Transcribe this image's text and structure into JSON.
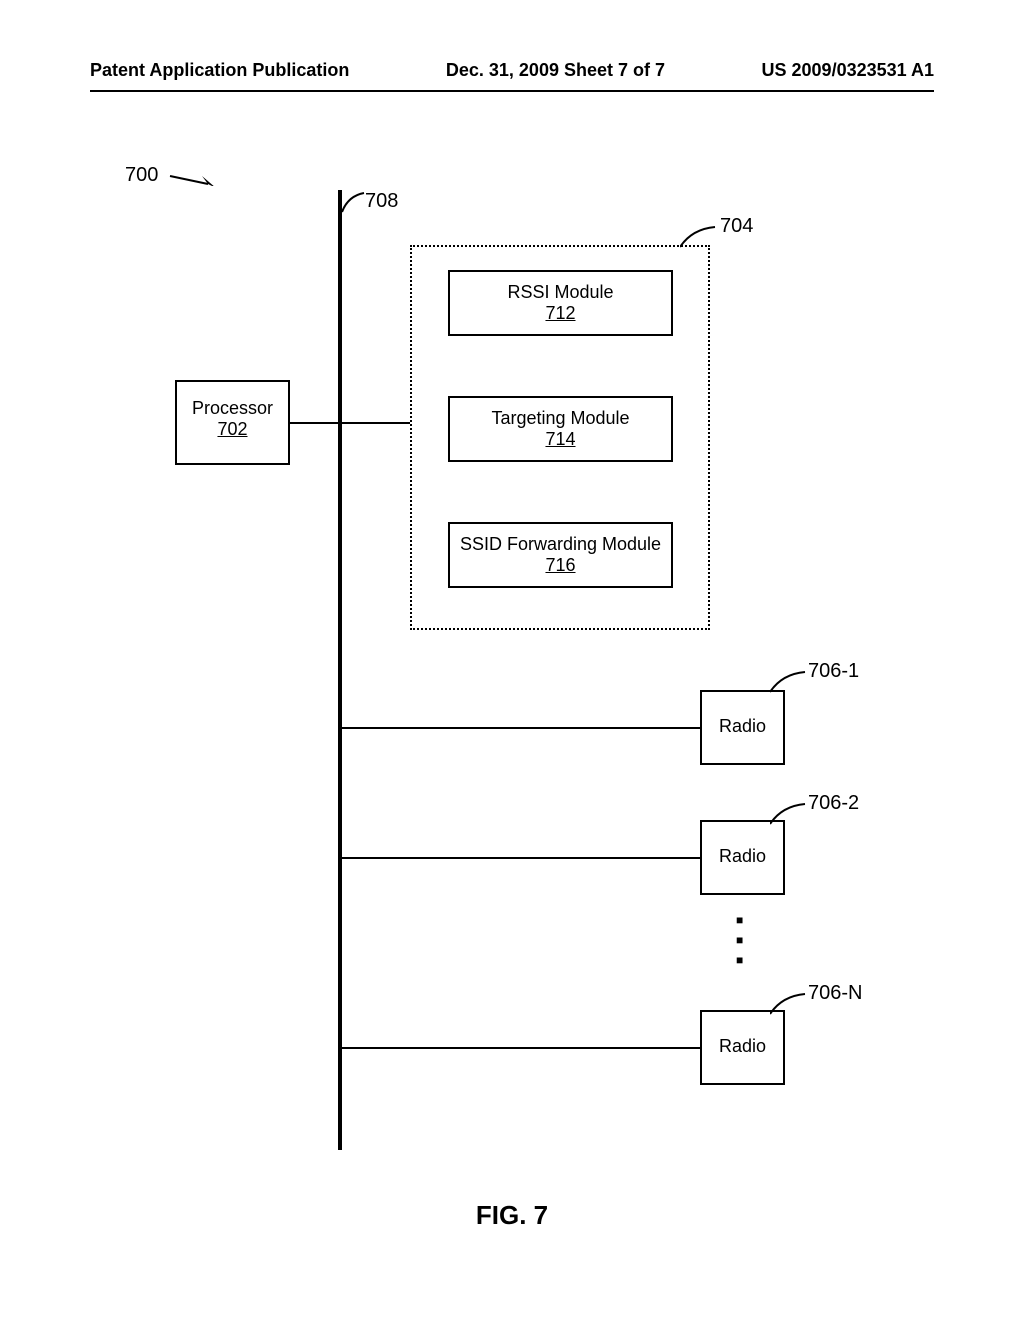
{
  "header": {
    "left": "Patent Application Publication",
    "center": "Dec. 31, 2009  Sheet 7 of 7",
    "right": "US 2009/0323531 A1"
  },
  "refs": {
    "system": "700",
    "bus": "708",
    "memory": "704",
    "radio1": "706-1",
    "radio2": "706-2",
    "radioN": "706-N"
  },
  "processor": {
    "label": "Processor",
    "ref": "702"
  },
  "modules": {
    "rssi": {
      "label": "RSSI Module",
      "ref": "712"
    },
    "targeting": {
      "label": "Targeting Module",
      "ref": "714"
    },
    "ssid": {
      "label": "SSID Forwarding Module",
      "ref": "716"
    }
  },
  "radio": {
    "label": "Radio"
  },
  "figure": "FIG. 7"
}
